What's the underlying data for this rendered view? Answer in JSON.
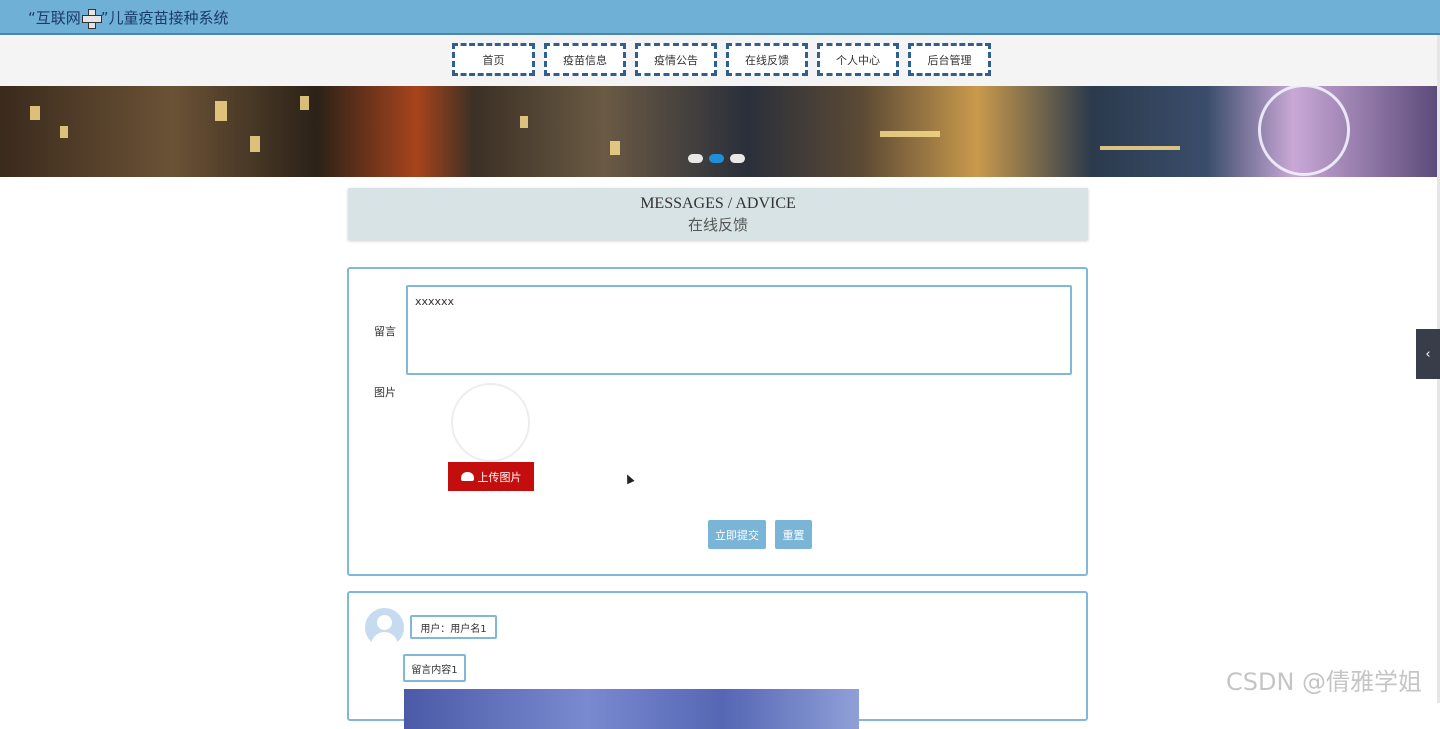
{
  "header": {
    "title_prefix": "“互联网",
    "title_suffix": "”儿童疫苗接种系统",
    "cross_icon": "plus-cross-icon"
  },
  "nav": {
    "items": [
      {
        "label": "首页"
      },
      {
        "label": "疫苗信息"
      },
      {
        "label": "疫情公告"
      },
      {
        "label": "在线反馈"
      },
      {
        "label": "个人中心"
      },
      {
        "label": "后台管理"
      }
    ]
  },
  "banner": {
    "slide_count": 3,
    "active_slide": 2
  },
  "section": {
    "title_en": "MESSAGES / ADVICE",
    "title_cn": "在线反馈"
  },
  "form": {
    "message_label": "留言",
    "message_value": "xxxxxx",
    "image_label": "图片",
    "upload_label": "上传图片",
    "submit_label": "立即提交",
    "reset_label": "重置"
  },
  "messages": [
    {
      "user": "用户：用户名1",
      "content": "留言内容1"
    }
  ],
  "watermark": "CSDN @倩雅学姐",
  "colors": {
    "header_bg": "#6fb0d6",
    "nav_border": "#2f5f92",
    "accent": "#7ab4d6",
    "upload_btn": "#c40d0d"
  }
}
